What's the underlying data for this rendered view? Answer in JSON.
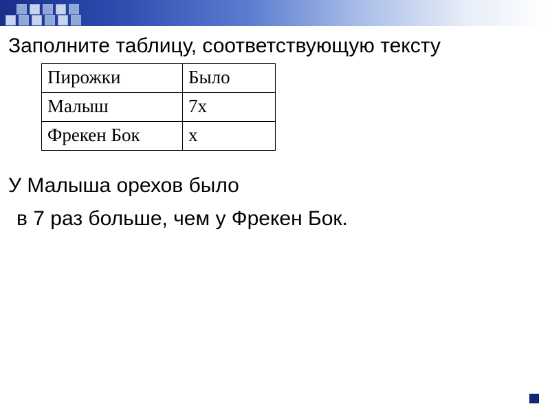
{
  "heading": "Заполните таблицу, соответствующую тексту",
  "table": {
    "rows": [
      {
        "c1": "Пирожки",
        "c2": "Было"
      },
      {
        "c1": "Малыш",
        "c2": "7х"
      },
      {
        "c1": "Фрекен Бок",
        "c2": "х"
      }
    ]
  },
  "line1": "У Малыша орехов было",
  "line2": " в 7 раз больше, чем у Фрекен Бок."
}
